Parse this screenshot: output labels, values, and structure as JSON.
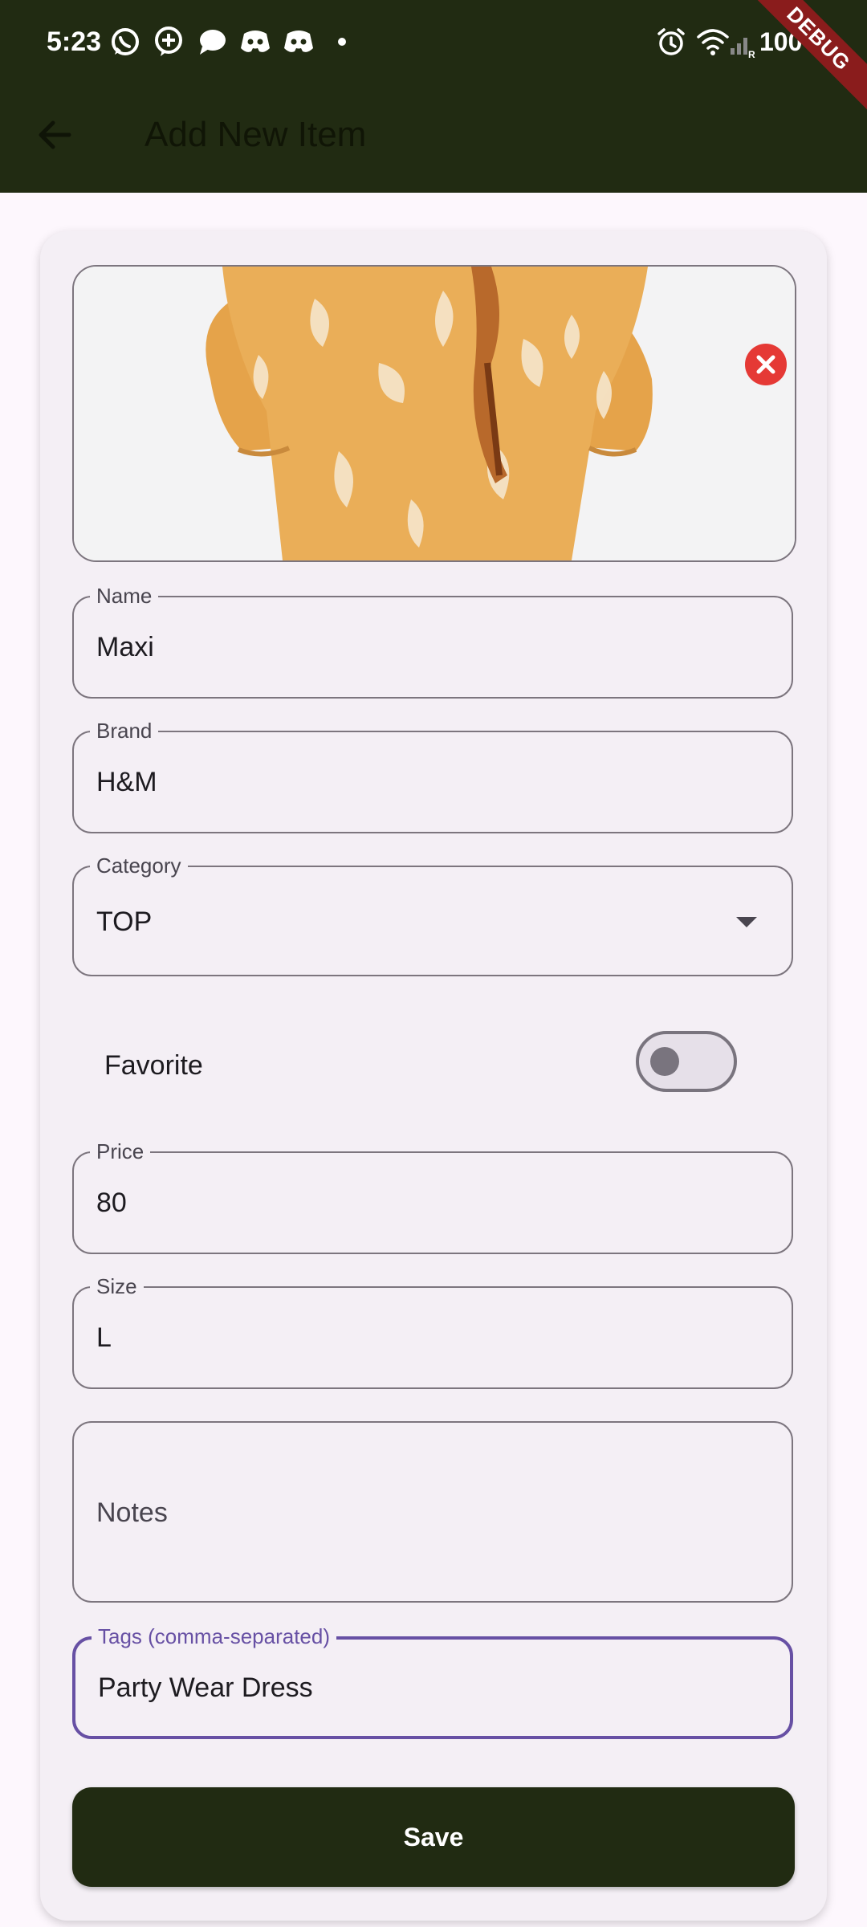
{
  "status_bar": {
    "time": "5:23",
    "battery": "100",
    "left_icons": [
      "whatsapp-icon",
      "chat-plus-icon",
      "message-bubble-icon",
      "discord-icon",
      "discord-icon",
      "dot-icon"
    ],
    "right_icons": [
      "alarm-icon",
      "wifi-icon",
      "signal-icon"
    ]
  },
  "debug_banner": "DEBUG",
  "app_bar": {
    "title": "Add New Item",
    "back_icon": "arrow-back-icon",
    "background_color": "#212b12"
  },
  "image_preview": {
    "remove_icon": "close-circle-icon",
    "remove_color": "#e53935"
  },
  "form": {
    "name": {
      "label": "Name",
      "value": "Maxi"
    },
    "brand": {
      "label": "Brand",
      "value": "H&M"
    },
    "category": {
      "label": "Category",
      "value": "TOP",
      "arrow_icon": "dropdown-arrow-icon"
    },
    "favorite": {
      "label": "Favorite",
      "enabled": false
    },
    "price": {
      "label": "Price",
      "value": "80"
    },
    "size": {
      "label": "Size",
      "value": "L"
    },
    "notes": {
      "placeholder": "Notes",
      "value": ""
    },
    "tags": {
      "label": "Tags (comma-separated)",
      "value": "Party Wear Dress",
      "focused": true,
      "focus_color": "#6750a4"
    }
  },
  "save_button": {
    "label": "Save",
    "color": "#212b12"
  }
}
